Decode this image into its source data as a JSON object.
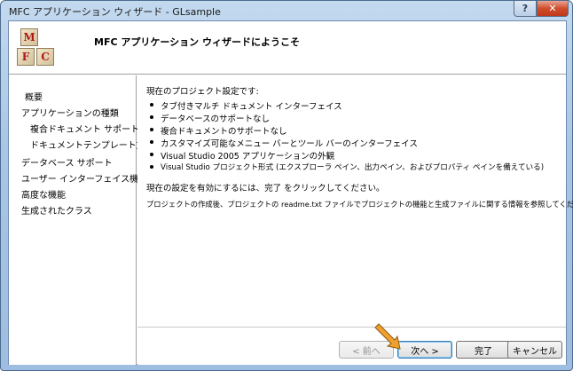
{
  "window": {
    "title": "MFC アプリケーション ウィザード - GLsample",
    "help_label": "?",
    "close_label": "✕"
  },
  "header": {
    "title": "MFC アプリケーション ウィザードにようこそ",
    "logo_letters": [
      "M",
      "F",
      "C"
    ]
  },
  "sidebar": {
    "items": [
      {
        "label": "概要"
      },
      {
        "label": "アプリケーションの種類"
      },
      {
        "label": "複合ドキュメント サポート"
      },
      {
        "label": "ドキュメントテンプレート文字列"
      },
      {
        "label": "データベース サポート"
      },
      {
        "label": "ユーザー インターフェイス機能"
      },
      {
        "label": "高度な機能"
      },
      {
        "label": "生成されたクラス"
      }
    ]
  },
  "main": {
    "intro": "現在のプロジェクト設定です:",
    "bullets": [
      "タブ付きマルチ ドキュメント インターフェイス",
      "データベースのサポートなし",
      "複合ドキュメントのサポートなし",
      "カスタマイズ可能なメニュー バーとツール バーのインターフェイス",
      "Visual Studio 2005 アプリケーションの外観",
      "Visual Studio プロジェクト形式 (エクスプローラ ペイン、出力ペイン、およびプロパティ ペインを備えている)"
    ],
    "instruction": "現在の設定を有効にするには、完了 をクリックしてください。",
    "note": "プロジェクトの作成後、プロジェクトの readme.txt ファイルでプロジェクトの機能と生成ファイルに関する情報を参照してください。"
  },
  "footer": {
    "back_label": "< 前へ",
    "next_label": "次へ >",
    "finish_label": "完了",
    "cancel_label": "キャンセル"
  },
  "colors": {
    "arrow": "#f0a030"
  }
}
